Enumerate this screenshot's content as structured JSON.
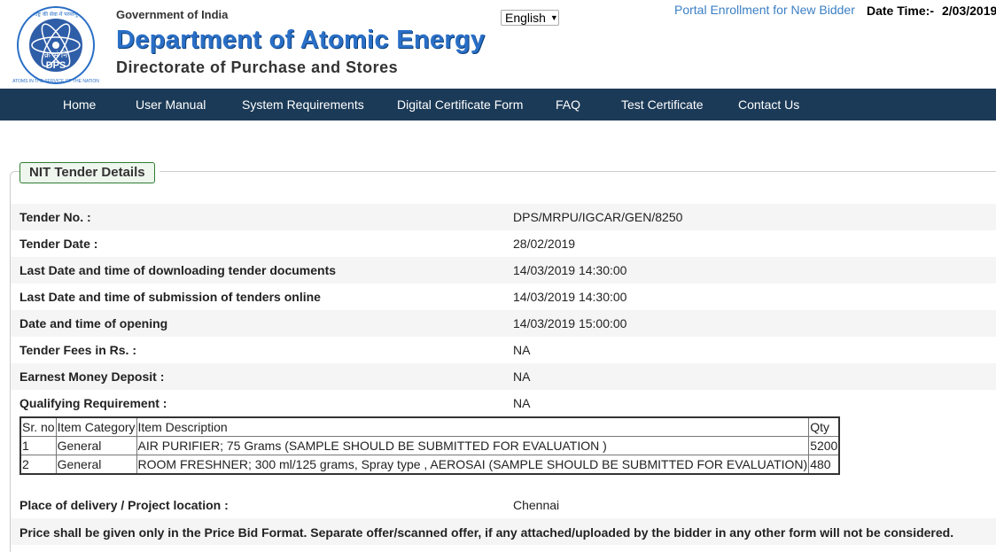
{
  "header": {
    "government": "Government of India",
    "department": "Department of Atomic Energy",
    "directorate": "Directorate of Purchase and Stores",
    "logo_text": {
      "top": "राष्ट्र की सेवा में परमाणु",
      "middle": "क्र भं नि",
      "abbr": "DPS",
      "bottom": "ATOMS IN THE SERVICE OF THE NATION"
    },
    "language": "English",
    "portal_link": "Portal Enrollment for New Bidder",
    "datetime_label": "Date Time:-",
    "datetime_value": "2/03/2019"
  },
  "nav": {
    "items": [
      "Home",
      "User Manual",
      "System Requirements",
      "Digital Certificate Form",
      "FAQ",
      "Test Certificate",
      "Contact Us"
    ]
  },
  "section": {
    "legend": "NIT Tender Details"
  },
  "details": [
    {
      "label": "Tender No. :",
      "value": "DPS/MRPU/IGCAR/GEN/8250"
    },
    {
      "label": "Tender Date :",
      "value": "28/02/2019"
    },
    {
      "label": "Last Date and time of downloading tender documents",
      "value": "14/03/2019 14:30:00"
    },
    {
      "label": "Last Date and time of submission of tenders online",
      "value": "14/03/2019 14:30:00"
    },
    {
      "label": "Date and time of opening",
      "value": "14/03/2019 15:00:00"
    },
    {
      "label": "Tender Fees in Rs. :",
      "value": "NA"
    },
    {
      "label": "Earnest Money Deposit :",
      "value": "NA"
    },
    {
      "label": "Qualifying Requirement :",
      "value": "NA"
    }
  ],
  "items_table": {
    "headers": [
      "Sr. no",
      "Item Category",
      "Item Description",
      "Qty"
    ],
    "rows": [
      [
        "1",
        "General",
        "AIR PURIFIER; 75 Grams (SAMPLE SHOULD BE SUBMITTED FOR EVALUATION )",
        "5200"
      ],
      [
        "2",
        "General",
        "ROOM FRESHNER; 300 ml/125 grams, Spray type , AEROSAI (SAMPLE SHOULD BE SUBMITTED FOR EVALUATION)",
        "480"
      ]
    ]
  },
  "delivery": {
    "label": "Place of delivery / Project location :",
    "value": "Chennai"
  },
  "note": "Price shall be given only in the Price Bid Format. Separate offer/scanned offer, if any attached/uploaded by the bidder in any other form will not be considered."
}
